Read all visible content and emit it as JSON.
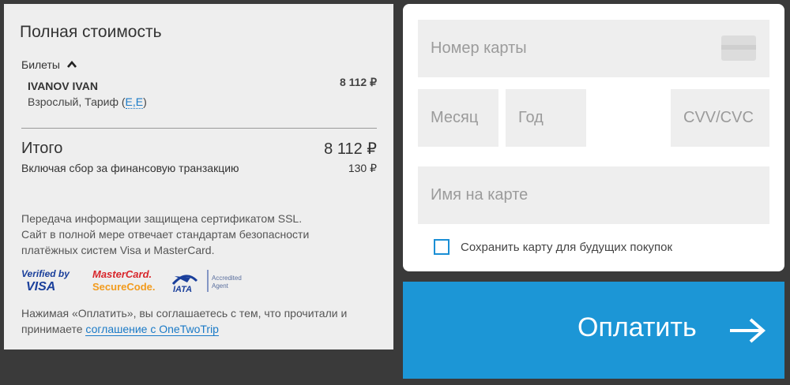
{
  "summary": {
    "title": "Полная стоимость",
    "tickets_label": "Билеты",
    "passenger": {
      "name": "IVANOV IVAN",
      "info_prefix": "Взрослый, Тариф (",
      "fare_code": "E,E",
      "info_suffix": ")",
      "price": "8 112 ₽"
    },
    "total_label": "Итого",
    "total_value": "8 112 ₽",
    "fee_label": "Включая сбор за финансовую транзакцию",
    "fee_value": "130 ₽",
    "ssl_lines": [
      "Передача информации защищена сертификатом SSL.",
      "Сайт в полной мере отвечает стандартам безопасности",
      "платёжных систем Visa и MasterCard."
    ],
    "logos": {
      "visa_top": "Verified by",
      "visa_bottom": "VISA",
      "mc_top": "MasterCard.",
      "mc_bottom": "SecureCode.",
      "iata": "IATA",
      "iata_note_1": "Accredited",
      "iata_note_2": "Agent"
    },
    "agree_text": "Нажимая «Оплатить», вы соглашаетесь с тем, что прочитали и принимаете ",
    "agree_link": "соглашение с OneTwoTrip"
  },
  "card_form": {
    "number_placeholder": "Номер карты",
    "month_placeholder": "Месяц",
    "year_placeholder": "Год",
    "cvv_placeholder": "CVV/CVC",
    "name_placeholder": "Имя на карте",
    "save_label": "Сохранить карту для будущих покупок"
  },
  "pay_button": {
    "label": "Оплатить"
  },
  "colors": {
    "accent": "#1c96d6",
    "link": "#1a7ac7"
  }
}
